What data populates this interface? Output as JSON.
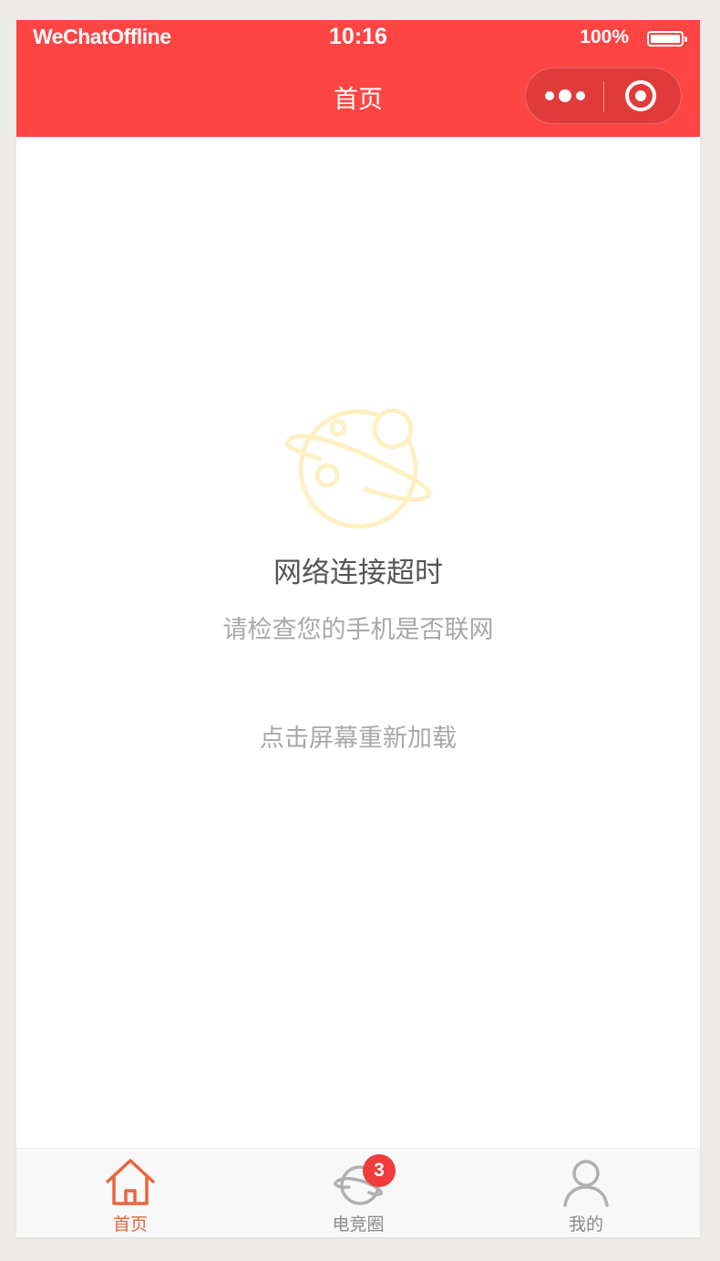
{
  "status_bar": {
    "carrier": "WeChatOffline",
    "time": "10:16",
    "battery": "100%"
  },
  "nav": {
    "title": "首页",
    "more_icon": "more-dots-icon",
    "close_icon": "target-close-icon"
  },
  "error": {
    "icon": "planet-icon",
    "title": "网络连接超时",
    "subtitle": "请检查您的手机是否联网",
    "reload": "点击屏幕重新加载"
  },
  "tabbar": {
    "items": [
      {
        "label": "首页",
        "icon": "home-icon",
        "active": true
      },
      {
        "label": "电竞圈",
        "icon": "planet-icon",
        "badge": "3",
        "active": false
      },
      {
        "label": "我的",
        "icon": "user-icon",
        "active": false
      }
    ]
  },
  "colors": {
    "brand": "#ff4444",
    "tab_active": "#e8673c",
    "tab_inactive": "#8a8a8a",
    "badge": "#f03c3c",
    "planet": "#fdf0c2"
  }
}
